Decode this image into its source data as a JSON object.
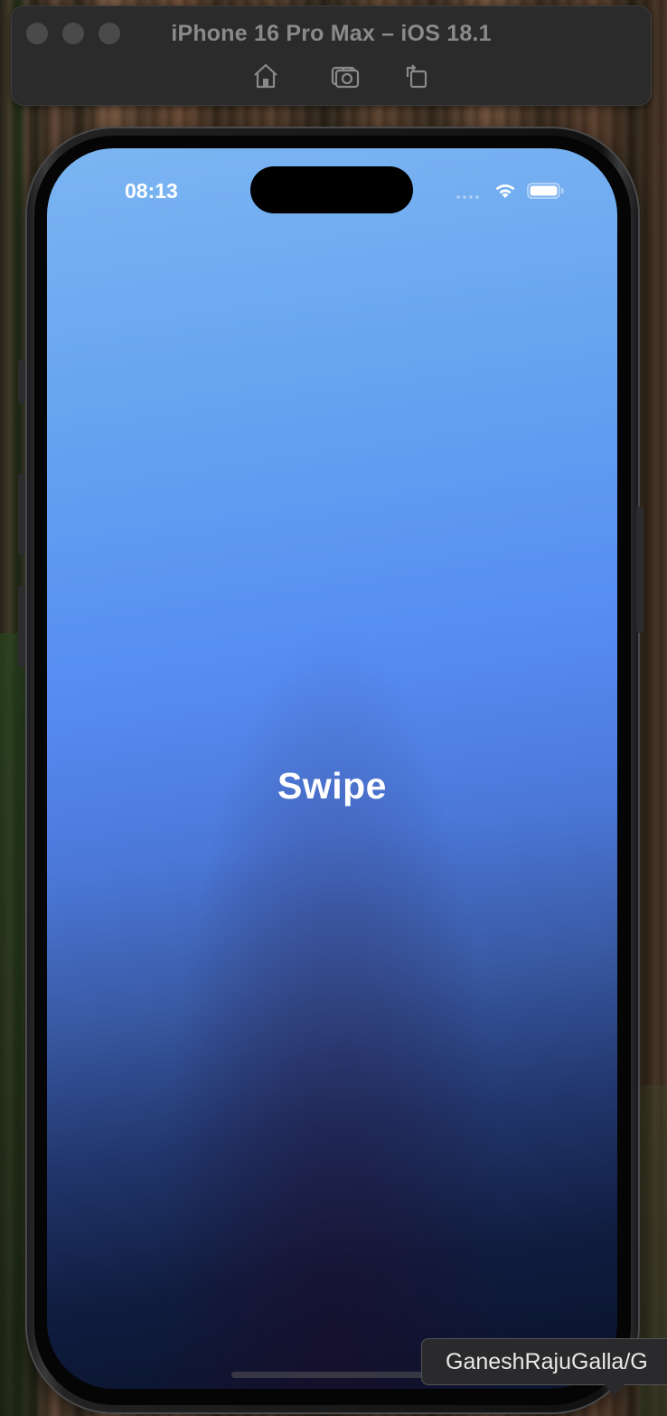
{
  "window": {
    "title": "iPhone 16 Pro Max – iOS 18.1",
    "toolbar": {
      "home_icon": "home-icon",
      "screenshot_icon": "screenshot-icon",
      "rotate_icon": "rotate-icon"
    }
  },
  "status_bar": {
    "time": "08:13",
    "signal_icon": "cellular-signal-icon",
    "wifi_icon": "wifi-icon",
    "battery_icon": "battery-icon"
  },
  "screen": {
    "label": "Swipe",
    "gradient_colors": [
      "#7bb5f2",
      "#568cf2",
      "#22376e",
      "#0a1229"
    ]
  },
  "tooltip": {
    "text": "GaneshRajuGalla/G"
  },
  "colors": {
    "title_text": "#8a8a8a",
    "screen_text": "#ffffff",
    "titlebar_bg": "#2b2b2b"
  }
}
